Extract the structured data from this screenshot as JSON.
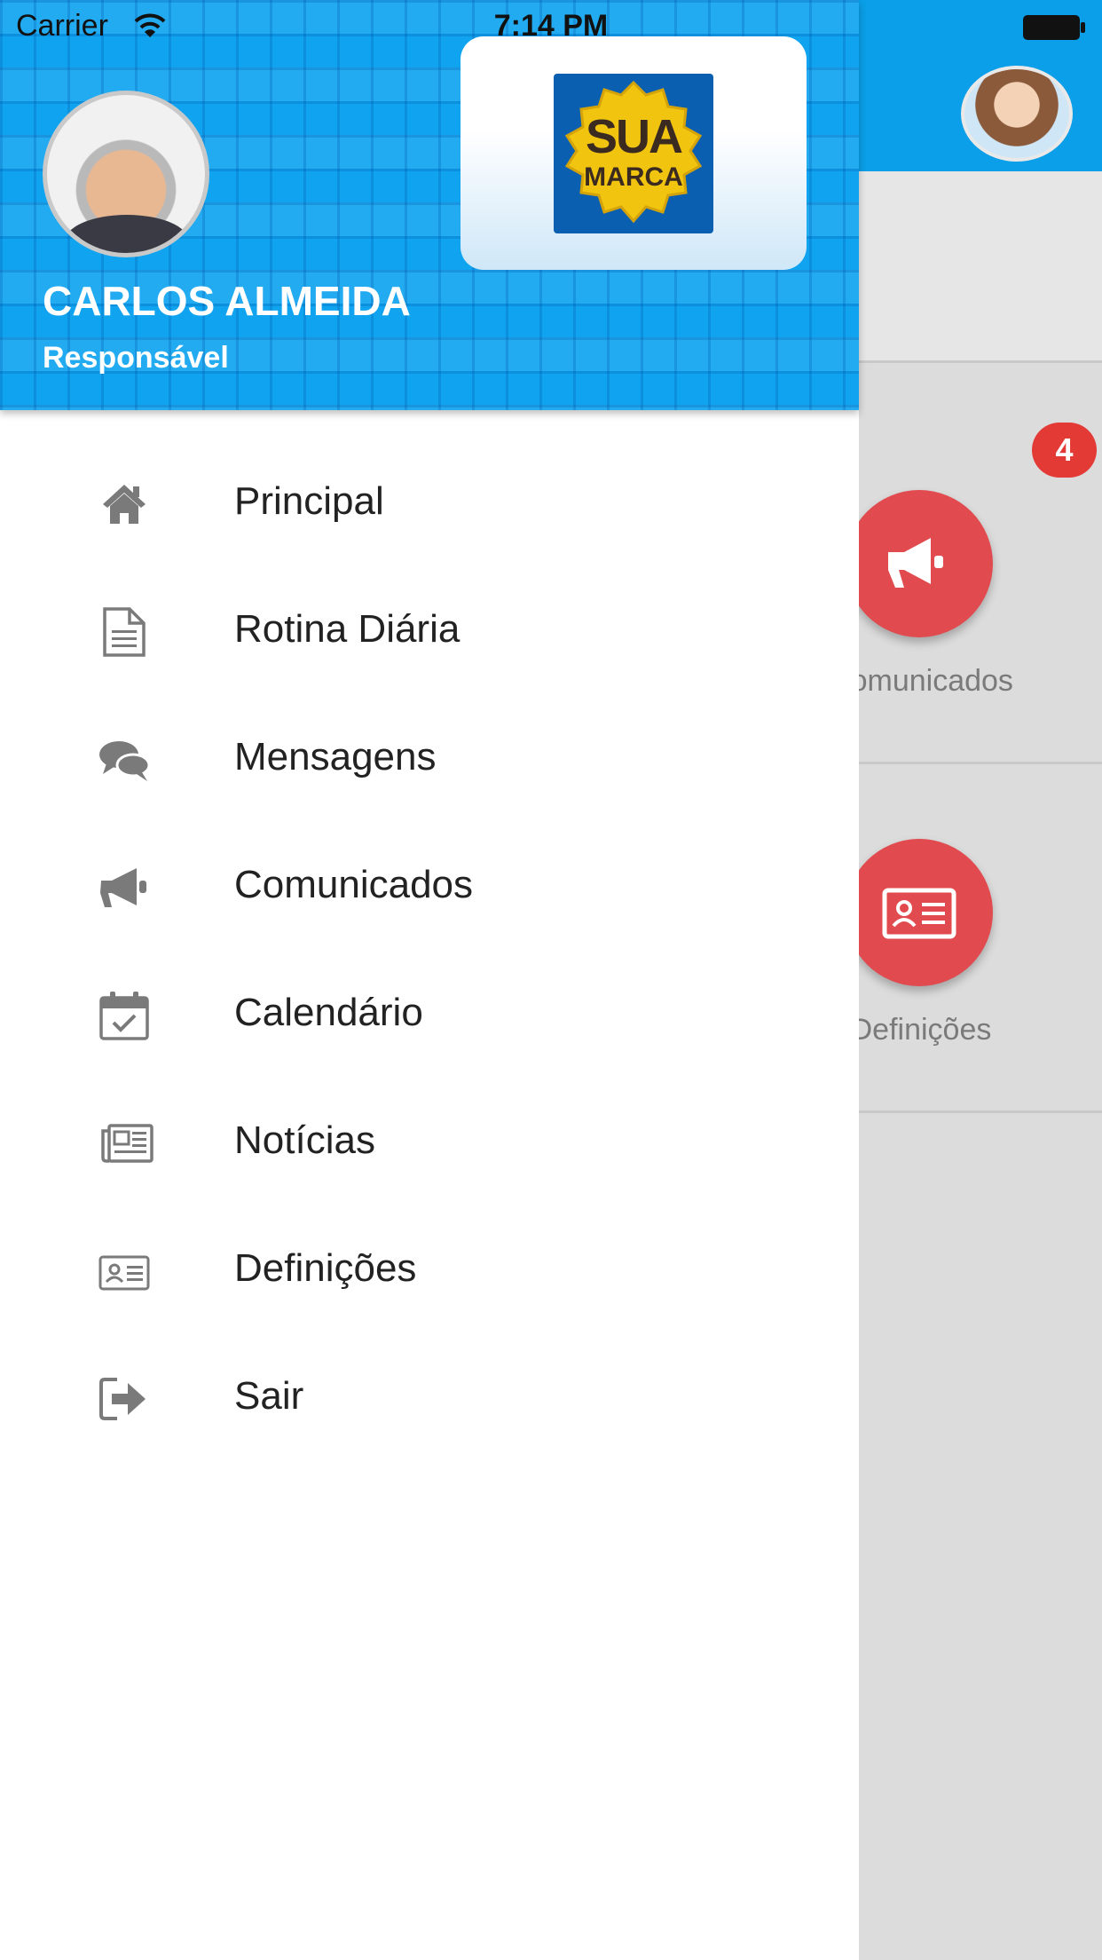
{
  "status_bar": {
    "carrier": "Carrier",
    "time": "7:14 PM"
  },
  "profile": {
    "name": "CARLOS ALMEIDA",
    "role": "Responsável"
  },
  "brand": {
    "line1": "SUA",
    "line2": "MARCA"
  },
  "menu": {
    "items": [
      {
        "label": "Principal",
        "icon": "home-icon"
      },
      {
        "label": "Rotina Diária",
        "icon": "document-icon"
      },
      {
        "label": "Mensagens",
        "icon": "chat-icon"
      },
      {
        "label": "Comunicados",
        "icon": "megaphone-icon"
      },
      {
        "label": "Calendário",
        "icon": "calendar-check-icon"
      },
      {
        "label": "Notícias",
        "icon": "newspaper-icon"
      },
      {
        "label": "Definições",
        "icon": "id-card-icon"
      },
      {
        "label": "Sair",
        "icon": "sign-out-icon"
      }
    ]
  },
  "background": {
    "badge_count": "4",
    "tiles": [
      {
        "label": "Comunicados",
        "icon": "megaphone-icon"
      },
      {
        "label": "Definições",
        "icon": "id-card-icon"
      }
    ]
  },
  "colors": {
    "primary": "#0a9fe8",
    "tile": "#e14a4e",
    "badge": "#e33a36",
    "icon": "#7a7a7a"
  }
}
